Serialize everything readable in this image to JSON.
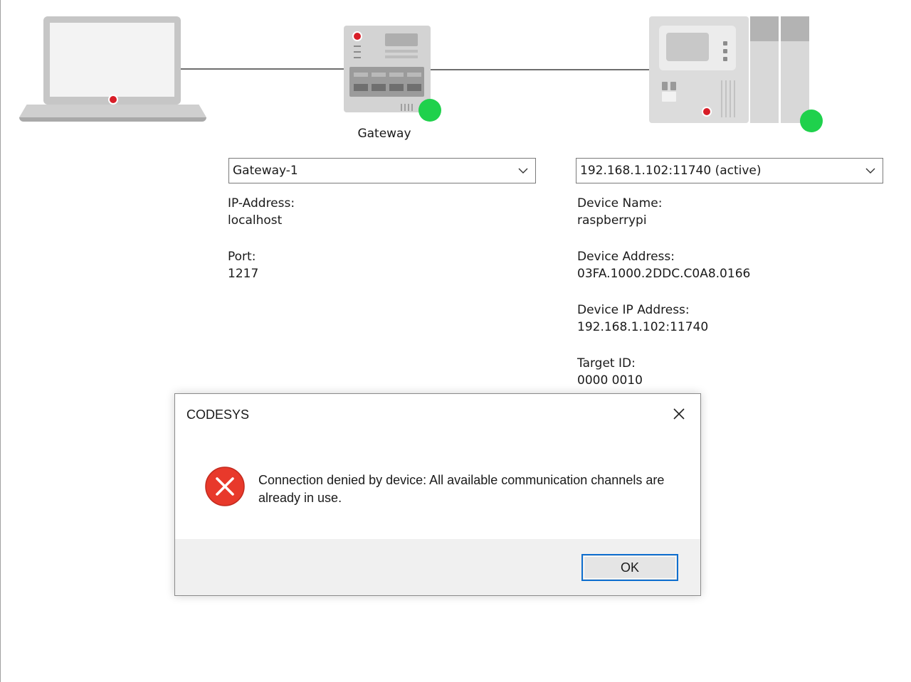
{
  "gateway": {
    "label": "Gateway",
    "selected": "Gateway-1",
    "fields": [
      {
        "label": "IP-Address:",
        "value": "localhost"
      },
      {
        "label": "Port:",
        "value": "1217"
      }
    ],
    "status_color": "#1fd14c"
  },
  "device": {
    "selected": "192.168.1.102:11740 (active)",
    "fields": [
      {
        "label": "Device Name:",
        "value": "raspberrypi"
      },
      {
        "label": "Device Address:",
        "value": "03FA.1000.2DDC.C0A8.0166"
      },
      {
        "label": "Device IP Address:",
        "value": "192.168.1.102:11740"
      },
      {
        "label": "Target ID:",
        "value": "0000 0010"
      }
    ],
    "status_color": "#1fd14c"
  },
  "dialog": {
    "title": "CODESYS",
    "message": "Connection denied by device: All available communication channels are already in use.",
    "ok_label": "OK",
    "icon": "error-icon",
    "icon_color": "#e8392b"
  },
  "accent_color": "#0f6fcf"
}
